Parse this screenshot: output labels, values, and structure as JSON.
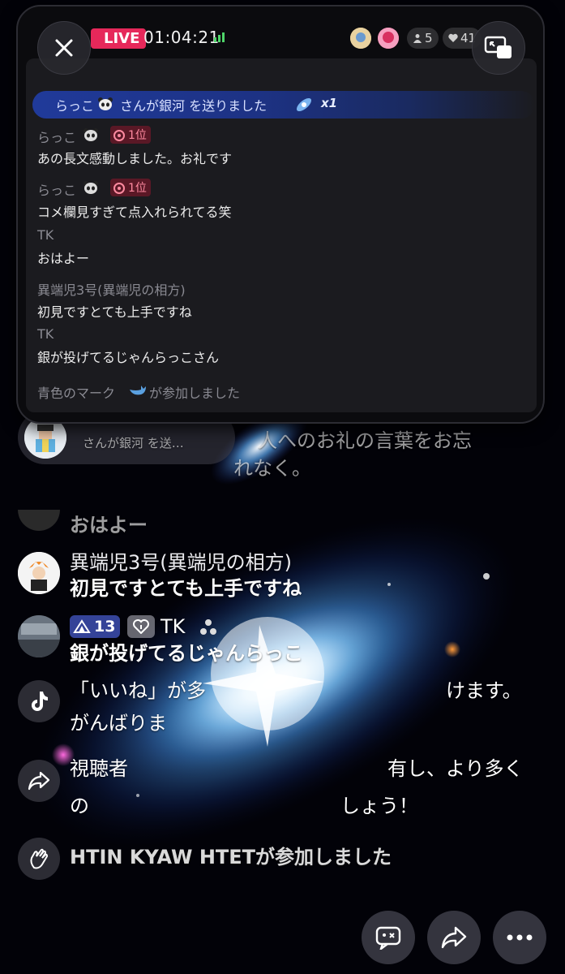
{
  "stream": {
    "live_label": "LIVE",
    "timer": "01:04:21",
    "viewer_count": "5",
    "like_count": "41",
    "gift_pill": {
      "line1": "",
      "line2": "さんが銀河 を送…"
    },
    "notice_top": "人へのお礼の言葉をお忘",
    "notice_top_2": "れなく。",
    "messages": [
      {
        "user": "",
        "text": "おはよー"
      },
      {
        "user": "異端児3号(異端児の相方)",
        "text": "初見ですとても上手ですね"
      },
      {
        "user": "TK",
        "level": "13",
        "text": "銀が投げてるじゃんらっこ"
      },
      {
        "text": "「いいね」が多",
        "text2": "けます。",
        "text3": "がんばりま"
      },
      {
        "text": "視聴者",
        "text2": "有し、より多く",
        "text3": "の",
        "text4": "しょう！"
      },
      {
        "text": "HTIN KYAW HTETが参加しました"
      }
    ]
  },
  "popup": {
    "gift_banner": {
      "user": "らっこ",
      "text": "さんが銀河 を送りました",
      "count": "x1"
    },
    "chat": [
      {
        "user": "らっこ",
        "rank": "1位",
        "text": "あの長文感動しました。お礼です"
      },
      {
        "user": "らっこ",
        "rank": "1位",
        "text": "コメ欄見すぎて点入れられてる笑"
      },
      {
        "user": "TK",
        "text": "おはよー"
      },
      {
        "user": "異端児3号(異端児の相方)",
        "text": "初見ですとても上手ですね"
      },
      {
        "user": "TK",
        "text": "銀が投げてるじゃんらっこさん"
      }
    ],
    "join_text_1": "青色のマーク",
    "join_text_2": "が参加しました"
  },
  "colors": {
    "live": "#e6285a",
    "banner": "#203a9a",
    "rank": "#5a1826"
  },
  "icons": [
    "close-icon",
    "exit-popup-icon",
    "person-icon",
    "heart-icon",
    "tiktok-icon",
    "share-icon",
    "wave-icon",
    "comment-icon",
    "more-icon"
  ]
}
